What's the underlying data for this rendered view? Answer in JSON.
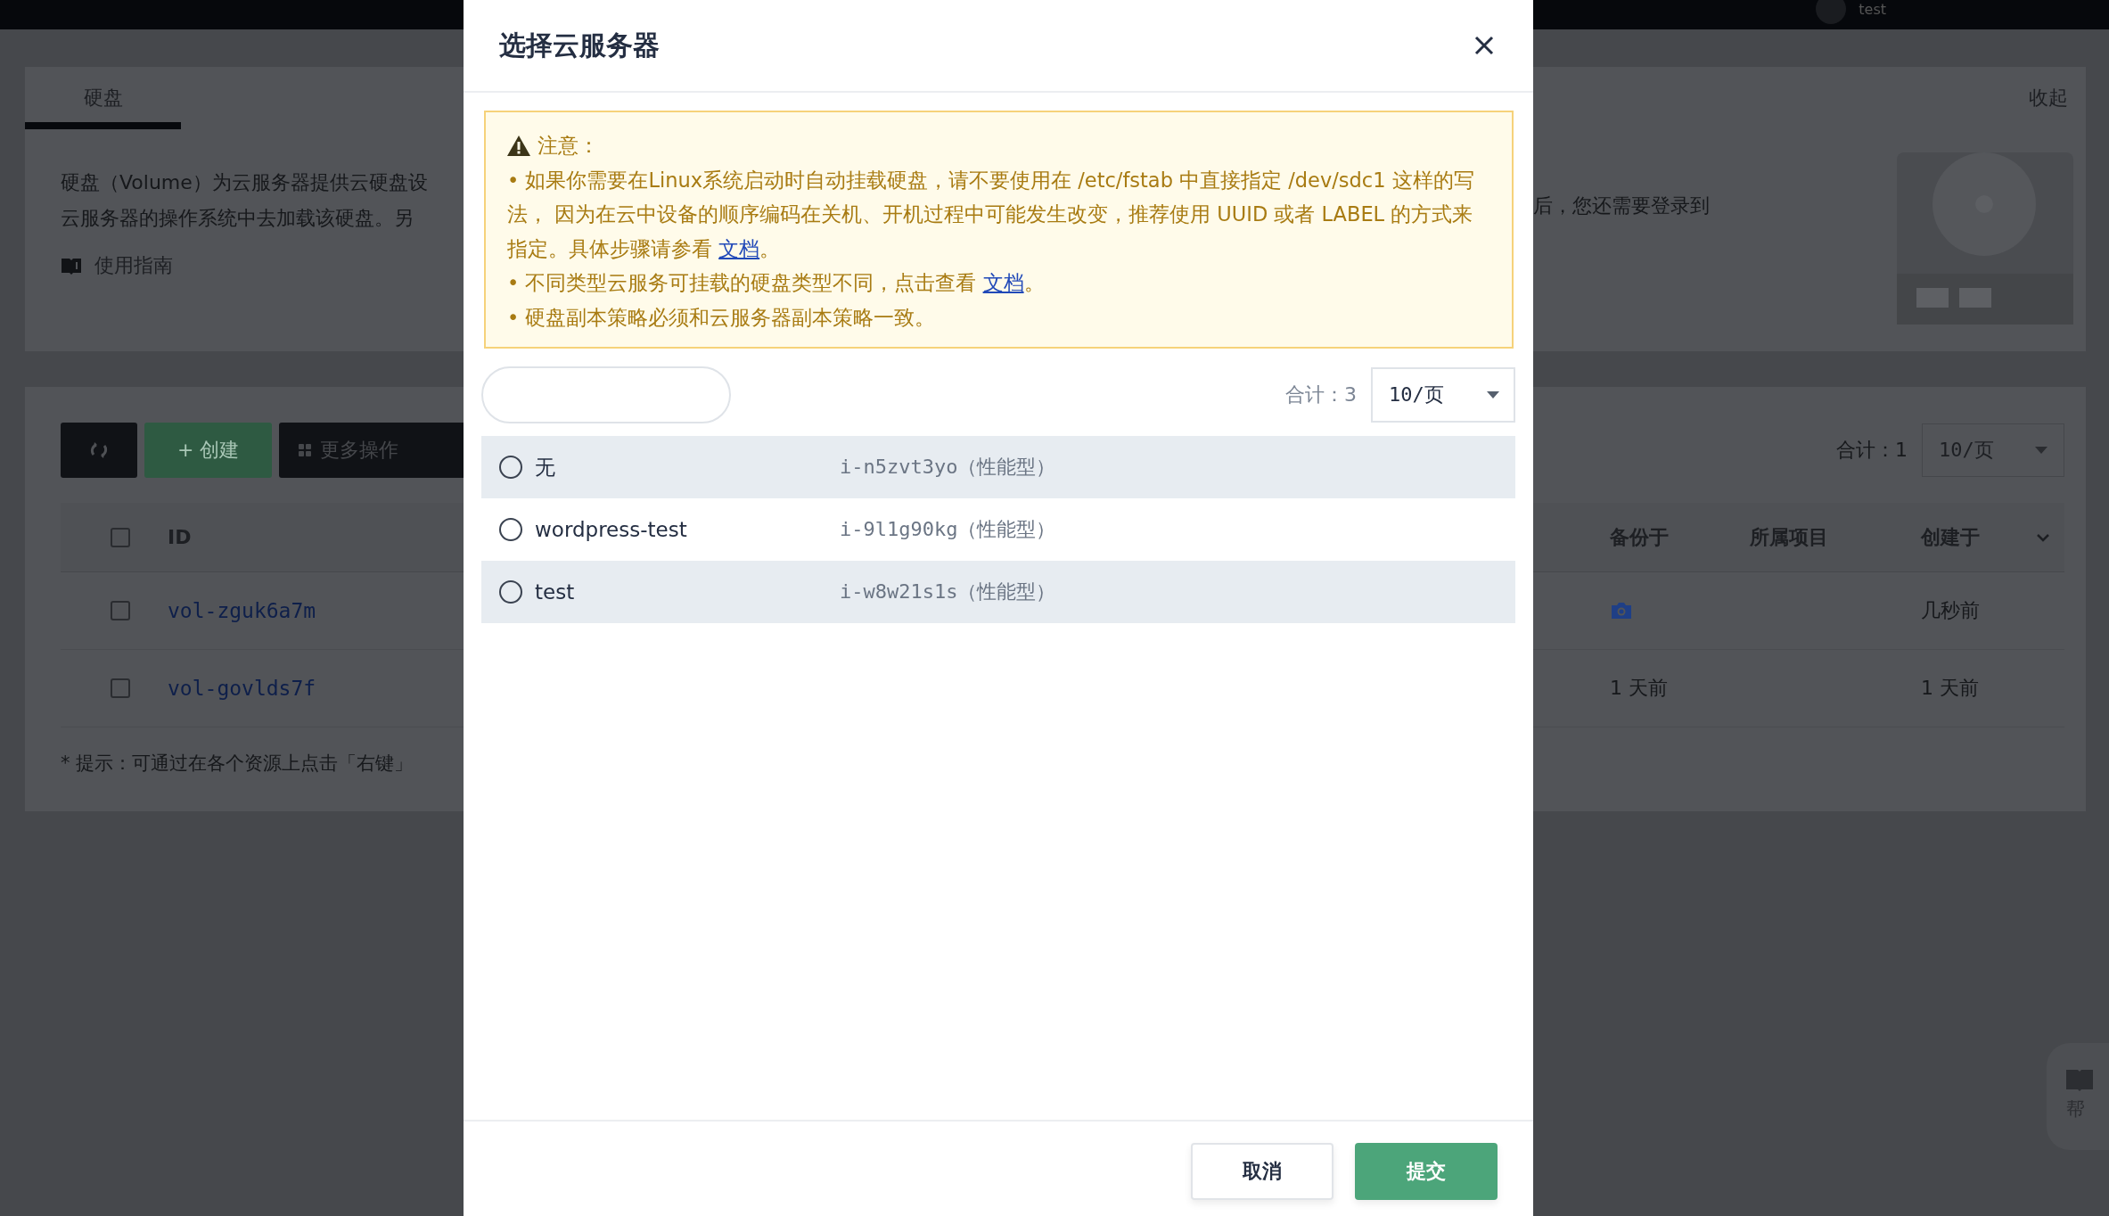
{
  "top_bar": {
    "user": "test"
  },
  "intro_card": {
    "tab": {
      "label": "硬盘",
      "selected": true
    },
    "collapse": "收起",
    "description_left": [
      "硬盘（Volume）为云服务器提供云硬盘设",
      "云服务器的操作系统中去加载该硬盘。另"
    ],
    "description_right": "后，您还需要登录到",
    "guide_link": "使用指南"
  },
  "list_card": {
    "toolbar": {
      "create": "+ 创建",
      "more": "更多操作"
    },
    "total": "合计：1",
    "page_size": "10/页",
    "select_all_checked": false,
    "columns": {
      "left": [
        "ID"
      ],
      "right": [
        "备份于",
        "所属项目",
        "创建于"
      ]
    },
    "rows": [
      {
        "id": "vol-zguk6a7m",
        "checked": false,
        "backup": "",
        "has_snapshot": true,
        "created": "几秒前"
      },
      {
        "id": "vol-govlds7f",
        "checked": false,
        "backup": "1 天前",
        "has_snapshot": false,
        "created": "1 天前"
      }
    ],
    "hint": "* 提示：可通过在各个资源上点击「右键」"
  },
  "help_widget": {
    "label": "帮"
  },
  "dialog": {
    "title": "选择云服务器",
    "notice": {
      "heading": "注意：",
      "items": [
        {
          "bullet": "•",
          "text": "如果你需要在Linux系统启动时自动挂载硬盘，请不要使用在 /etc/fstab 中直接指定 /dev/sdc1 这样的写法， 因为在云中设备的顺序编码在关机、开机过程中可能发生改变，推荐使用 UUID 或者 LABEL 的方式来指定。具体步骤请参看 ",
          "link": "文档",
          "tail": "。"
        },
        {
          "bullet": "•",
          "text": "不同类型云服务可挂载的硬盘类型不同，点击查看 ",
          "link": "文档",
          "tail": "。"
        },
        {
          "bullet": "•",
          "text": "硬盘副本策略必须和云服务器副本策略一致。"
        }
      ]
    },
    "total": "合计：3",
    "page_size": "10/页",
    "servers": [
      {
        "name": "无",
        "id": "i-n5zvt3yo（性能型）",
        "selected": false
      },
      {
        "name": "wordpress-test",
        "id": "i-9l1g90kg（性能型）",
        "selected": false
      },
      {
        "name": "test",
        "id": "i-w8w21s1s（性能型）",
        "selected": false
      }
    ],
    "buttons": {
      "cancel": "取消",
      "submit": "提交"
    }
  }
}
